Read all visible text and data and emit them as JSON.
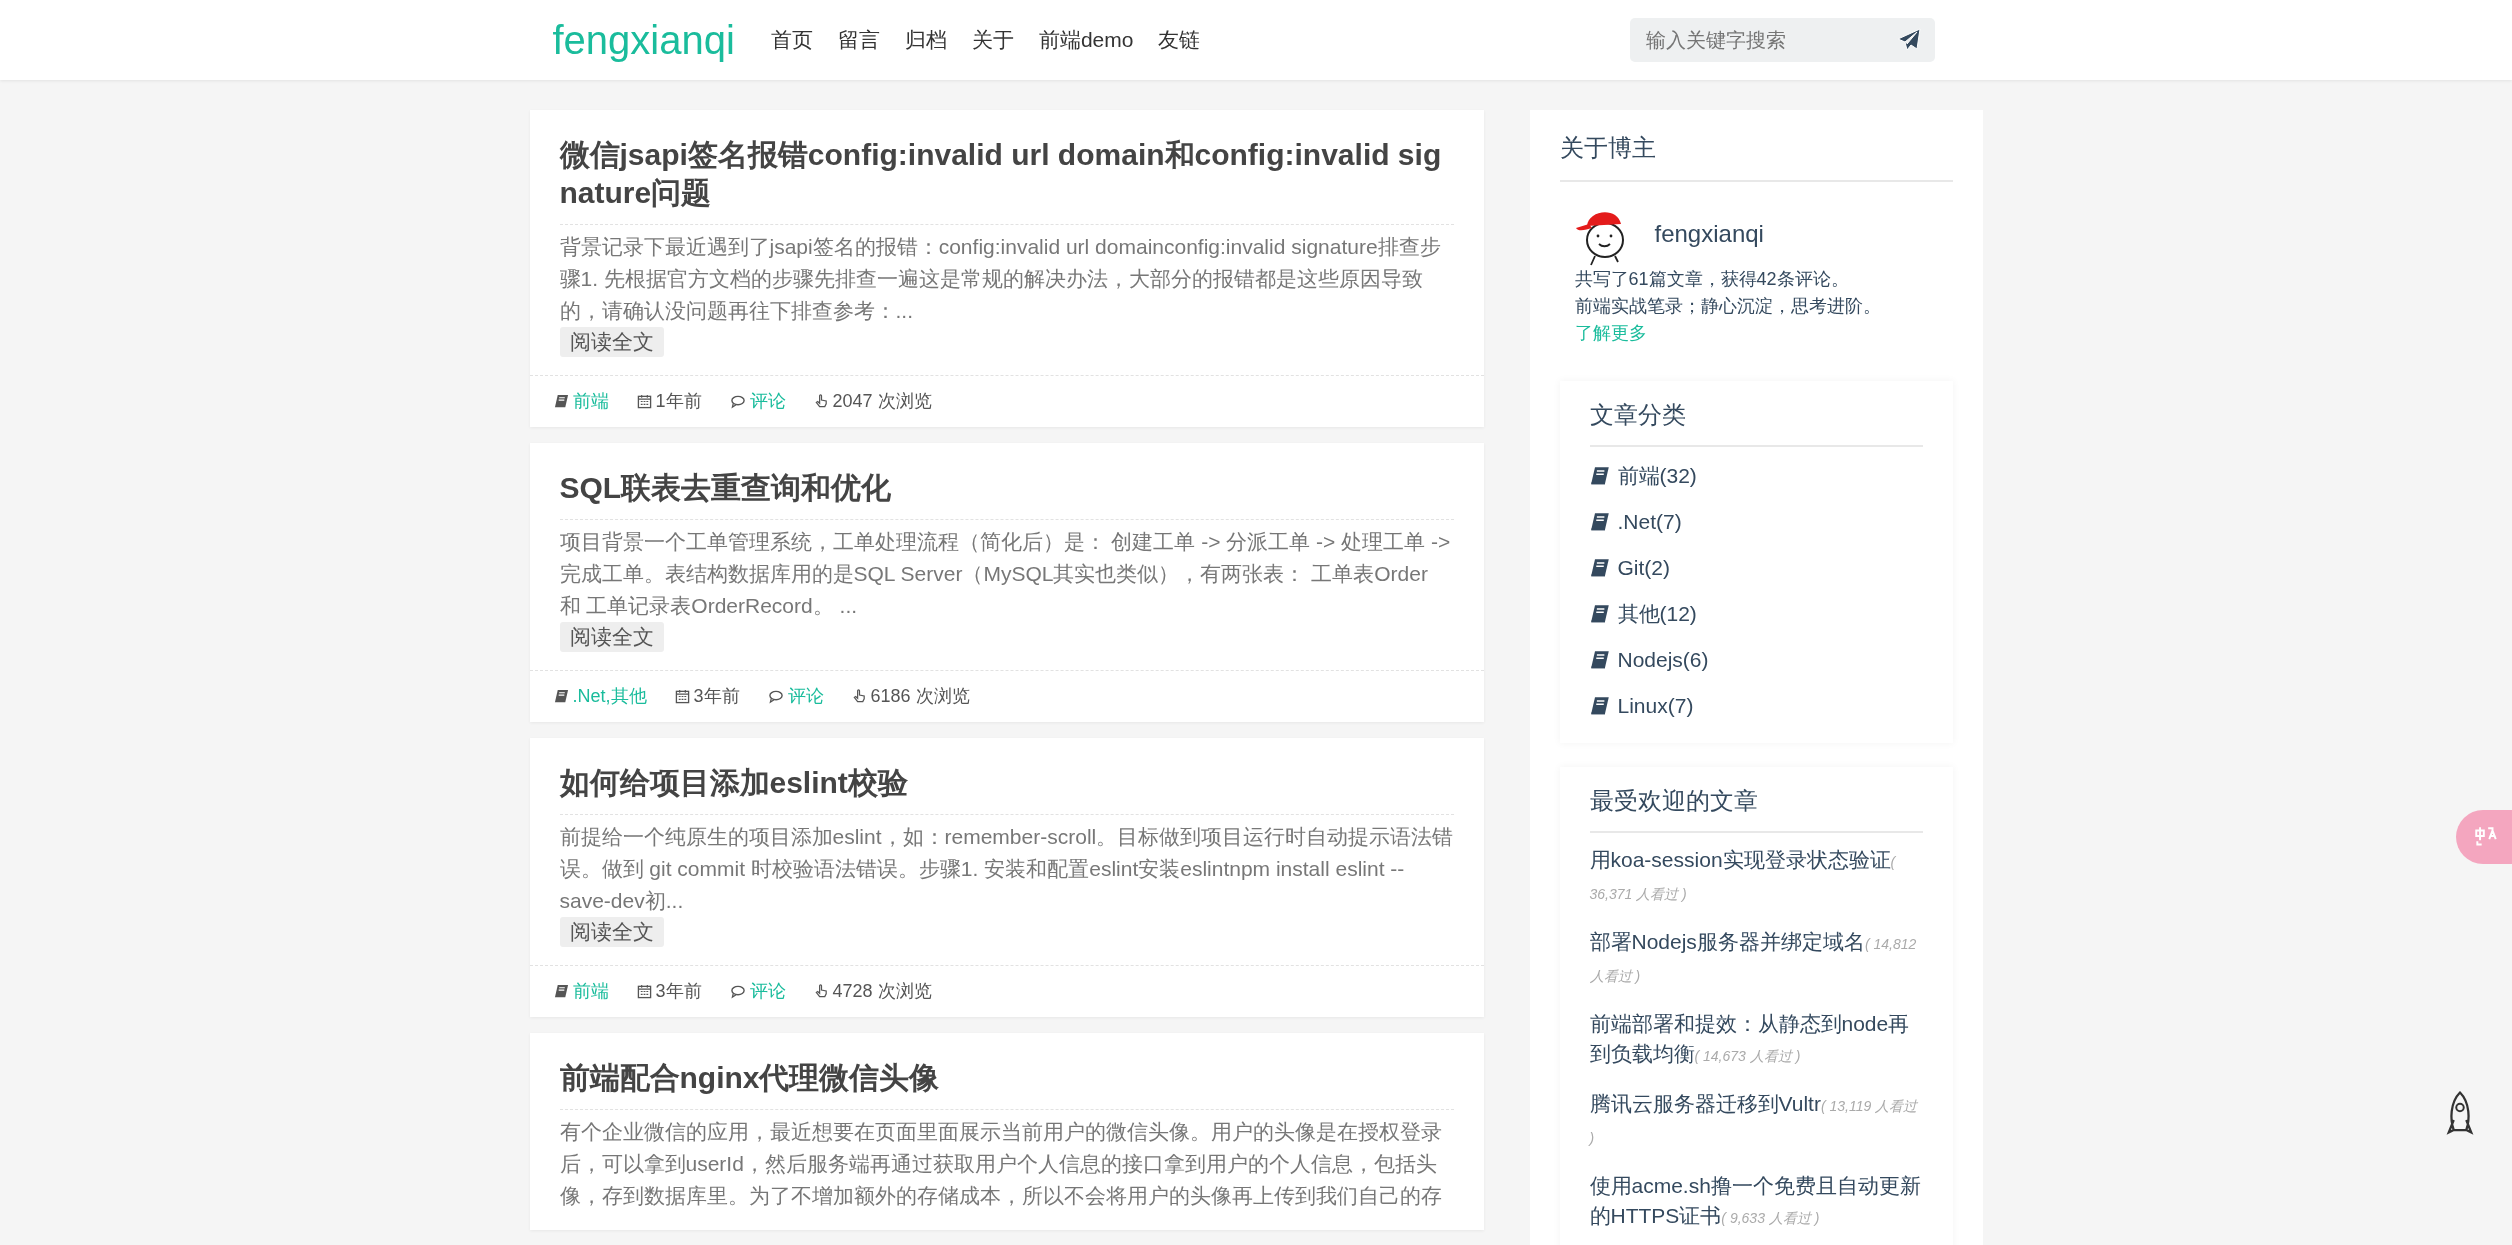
{
  "header": {
    "logo": "fengxianqi",
    "nav": [
      {
        "label": "首页"
      },
      {
        "label": "留言"
      },
      {
        "label": "归档"
      },
      {
        "label": "关于"
      },
      {
        "label": "前端demo"
      },
      {
        "label": "友链"
      }
    ],
    "search": {
      "placeholder": "输入关键字搜索"
    }
  },
  "articles": [
    {
      "title": "微信jsapi签名报错config:invalid url domain和config:invalid signature问题",
      "excerpt": "背景记录下最近遇到了jsapi签名的报错：config:invalid url domainconfig:invalid signature排查步骤1. 先根据官方文档的步骤先排查一遍这是常规的解决办法，大部分的报错都是这些原因导致的，请确认没问题再往下排查参考：...",
      "read_more": "阅读全文",
      "category": "前端",
      "time": "1年前",
      "comments": "评论",
      "views": "2047 次浏览"
    },
    {
      "title": "SQL联表去重查询和优化",
      "excerpt": "项目背景一个工单管理系统，工单处理流程（简化后）是： 创建工单 -> 分派工单 -> 处理工单 -> 完成工单。表结构数据库用的是SQL Server（MySQL其实也类似），有两张表： 工单表Order 和 工单记录表OrderRecord。 ...",
      "read_more": "阅读全文",
      "category": ".Net,其他",
      "time": "3年前",
      "comments": "评论",
      "views": "6186 次浏览"
    },
    {
      "title": "如何给项目添加eslint校验",
      "excerpt": "前提给一个纯原生的项目添加eslint，如：remember-scroll。目标做到项目运行时自动提示语法错误。做到 git commit 时校验语法错误。步骤1. 安装和配置eslint安装eslintnpm install eslint --save-dev初...",
      "read_more": "阅读全文",
      "category": "前端",
      "time": "3年前",
      "comments": "评论",
      "views": "4728 次浏览"
    },
    {
      "title": "前端配合nginx代理微信头像",
      "excerpt": "有个企业微信的应用，最近想要在页面里面展示当前用户的微信头像。用户的头像是在授权登录后，可以拿到userId，然后服务端再通过获取用户个人信息的接口拿到用户的个人信息，包括头像，存到数据库里。为了不增加额外的存储成本，所以不会将用户的头像再上传到我们自己的存"
    }
  ],
  "sidebar": {
    "about": {
      "heading": "关于博主",
      "name": "fengxianqi",
      "stats": "共写了61篇文章，获得42条评论。",
      "motto": "前端实战笔录；静心沉淀，思考进阶。",
      "more_link": "了解更多"
    },
    "categories": {
      "heading": "文章分类",
      "items": [
        {
          "label": "前端(32)"
        },
        {
          "label": ".Net(7)"
        },
        {
          "label": "Git(2)"
        },
        {
          "label": "其他(12)"
        },
        {
          "label": "Nodejs(6)"
        },
        {
          "label": "Linux(7)"
        }
      ]
    },
    "popular": {
      "heading": "最受欢迎的文章",
      "items": [
        {
          "title": "用koa-session实现登录状态验证",
          "views": "( 36,371 人看过 )"
        },
        {
          "title": "部署Nodejs服务器并绑定域名",
          "views": "( 14,812 人看过 )"
        },
        {
          "title": "前端部署和提效：从静态到node再到负载均衡",
          "views": "( 14,673 人看过 )"
        },
        {
          "title": "腾讯云服务器迁移到Vultr",
          "views": "( 13,119 人看过 )"
        },
        {
          "title": "使用acme.sh撸一个免费且自动更新的HTTPS证书",
          "views": "( 9,633 人看过 )"
        }
      ]
    }
  }
}
